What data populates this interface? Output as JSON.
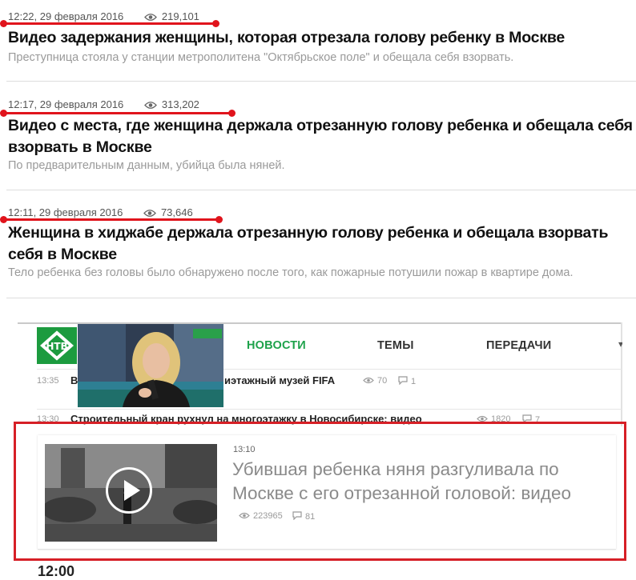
{
  "articles": [
    {
      "time": "12:22, 29 февраля 2016",
      "views": "219,101",
      "headline": "Видео задержания женщины, которая отрезала голову ребенку в Москве",
      "lead": "Преступница стояла у станции метрополитена \"Октябрьское поле\" и обещала себя взорвать."
    },
    {
      "time": "12:17, 29 февраля 2016",
      "views": "313,202",
      "headline": "Видео с места, где женщина держала отрезанную голову ребенка и обещала себя взорвать в Москве",
      "lead": "По предварительным данным, убийца была няней."
    },
    {
      "time": "12:11, 29 февраля 2016",
      "views": "73,646",
      "headline": "Женщина в хиджабе держала отрезанную голову ребенка и обещала взорвать себя в Москве",
      "lead": "Тело ребенка без головы было обнаружено после того, как пожарные потушили пожар в квартире дома."
    }
  ],
  "embedded_site": {
    "logo_icon": "ntv-logo-icon",
    "nav": [
      "НОВОСТИ",
      "ТЕМЫ",
      "ПЕРЕДАЧИ"
    ],
    "nav_active_color": "#1ea24b",
    "news": [
      {
        "time": "13:35",
        "title_start": "В",
        "title_end": "иэтажный музей FIFA",
        "views": "70",
        "comments": "1"
      },
      {
        "time": "13:30",
        "title": "Строительный кран рухнул на многоэтажку в Новосибирске: видео",
        "views": "1820",
        "comments": "7"
      }
    ],
    "feature": {
      "time": "13:10",
      "title": "Убившая ребенка няня разгуливала по Москве с его отрезанной головой: видео",
      "views": "223965",
      "comments": "81",
      "play_icon": "play-icon"
    },
    "bottom_time": "12:00"
  },
  "colors": {
    "annotation_red": "#e0141c",
    "highlight_red": "#d61f26",
    "ntv_green": "#1c9b3f"
  }
}
